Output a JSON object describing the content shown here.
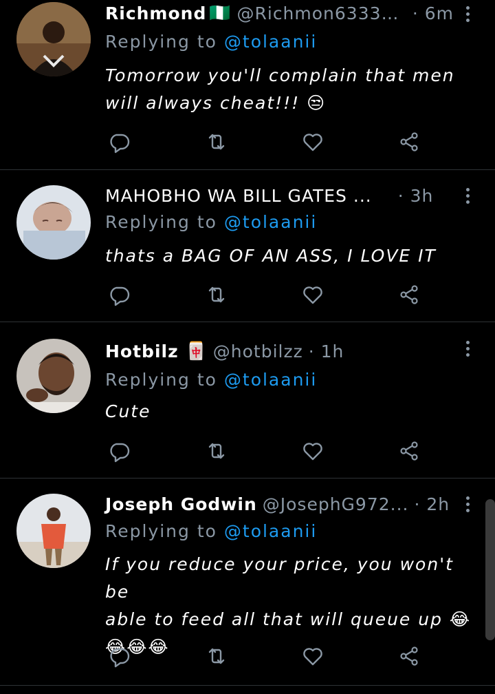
{
  "tweets": [
    {
      "name": "Richmond",
      "flag": "🇳🇬",
      "handle": "@Richmon63332...",
      "time": "· 6m",
      "replying_label": "Replying to ",
      "mention": "@tolaanii",
      "text": "Tomorrow you'll complain that men\nwill always cheat!!! 😒"
    },
    {
      "name": "MAHOBHO WA BILL GATES ...",
      "flag": "",
      "handle": "",
      "time": "· 3h",
      "replying_label": "Replying to ",
      "mention": "@tolaanii",
      "text": "thats a BAG OF AN ASS, I LOVE IT"
    },
    {
      "name": "Hotbilz",
      "flag": "🀄",
      "handle": "@hotbilzz",
      "time": "· 1h",
      "replying_label": "Replying to ",
      "mention": "@tolaanii",
      "text": "Cute"
    },
    {
      "name": "Joseph Godwin",
      "flag": "",
      "handle": "@JosephG972...",
      "time": "· 2h",
      "replying_label": "Replying to ",
      "mention": "@tolaanii",
      "text": "If you reduce your price, you won't be\nable to feed all that will queue up 😂\n😂😂😂"
    }
  ],
  "icons": {
    "reply": "reply-icon",
    "retweet": "retweet-icon",
    "like": "like-icon",
    "share": "share-icon",
    "more": "more-options-icon"
  },
  "colors": {
    "background": "#000000",
    "secondary_text": "#8b98a5",
    "mention": "#1d9bf0",
    "divider": "#2f3336"
  }
}
